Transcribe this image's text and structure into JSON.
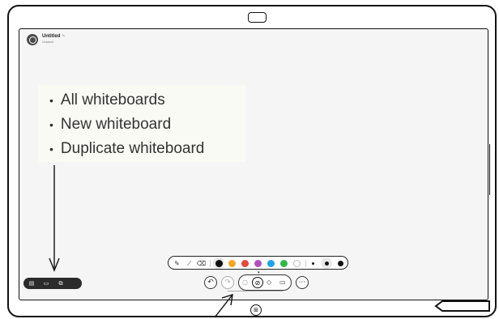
{
  "whiteboard": {
    "title": "Untitled",
    "subtitle": "Unsaved"
  },
  "callout": {
    "items": [
      "All whiteboards",
      "New whiteboard",
      "Duplicate whiteboard"
    ]
  },
  "toolbar": {
    "colors": [
      "#111111",
      "#f5a623",
      "#e8453c",
      "#b24fc0",
      "#1aa5e6",
      "#2fb84a",
      "#ffffff"
    ],
    "selected_color": "#111111",
    "pen_sizes": [
      "small",
      "medium",
      "large"
    ]
  },
  "icons": {
    "pen": "✎",
    "highlighter": "⟋",
    "eraser": "⌫",
    "undo": "↶",
    "redo": "↷",
    "lasso": "◌",
    "shapes": "◇",
    "sticky": "▭",
    "more": "⋯",
    "home": "⊞",
    "all_boards": "▤",
    "new_board": "▭",
    "duplicate": "⧉"
  }
}
